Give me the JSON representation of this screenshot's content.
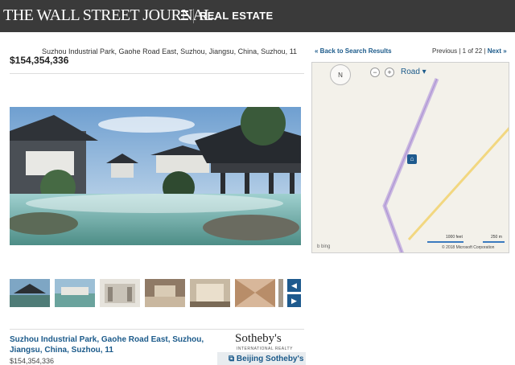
{
  "header": {
    "brand": "THE WALL STREET JOURNAL.",
    "section": "REAL ESTATE"
  },
  "listing": {
    "address_line": "Suzhou Industrial Park, Gaohe Road East, Suzhou, Jiangsu, China, Suzhou, 11",
    "price": "$154,354,336",
    "address_title": "Suzhou Industrial Park, Gaohe Road East, Suzhou, Jiangsu, China, Suzhou, 11",
    "price_bottom": "$154,354,336"
  },
  "gallery": {
    "prev_label": "◀",
    "next_label": "▶"
  },
  "navigation": {
    "back_label": "« Back to Search Results",
    "previous_label": "Previous",
    "position": "1 of 22",
    "next_label": "Next »"
  },
  "map": {
    "compass_label": "N",
    "zoom_out": "−",
    "zoom_in": "+",
    "mode": "Road ▾",
    "scale_feet": "1000 feet",
    "scale_meters": "250 m",
    "provider": "b bing",
    "copyright": "© 2018 Microsoft Corporation",
    "pin_icon": "house-icon"
  },
  "agent": {
    "brokerage_logo": "Sotheby's",
    "brokerage_sub": "INTERNATIONAL REALTY",
    "agent_link": "Beijing Sotheby's"
  },
  "colors": {
    "header_bg": "#3a3a3a",
    "link_blue": "#1b5a8a",
    "button_blue": "#1e5a8e"
  }
}
